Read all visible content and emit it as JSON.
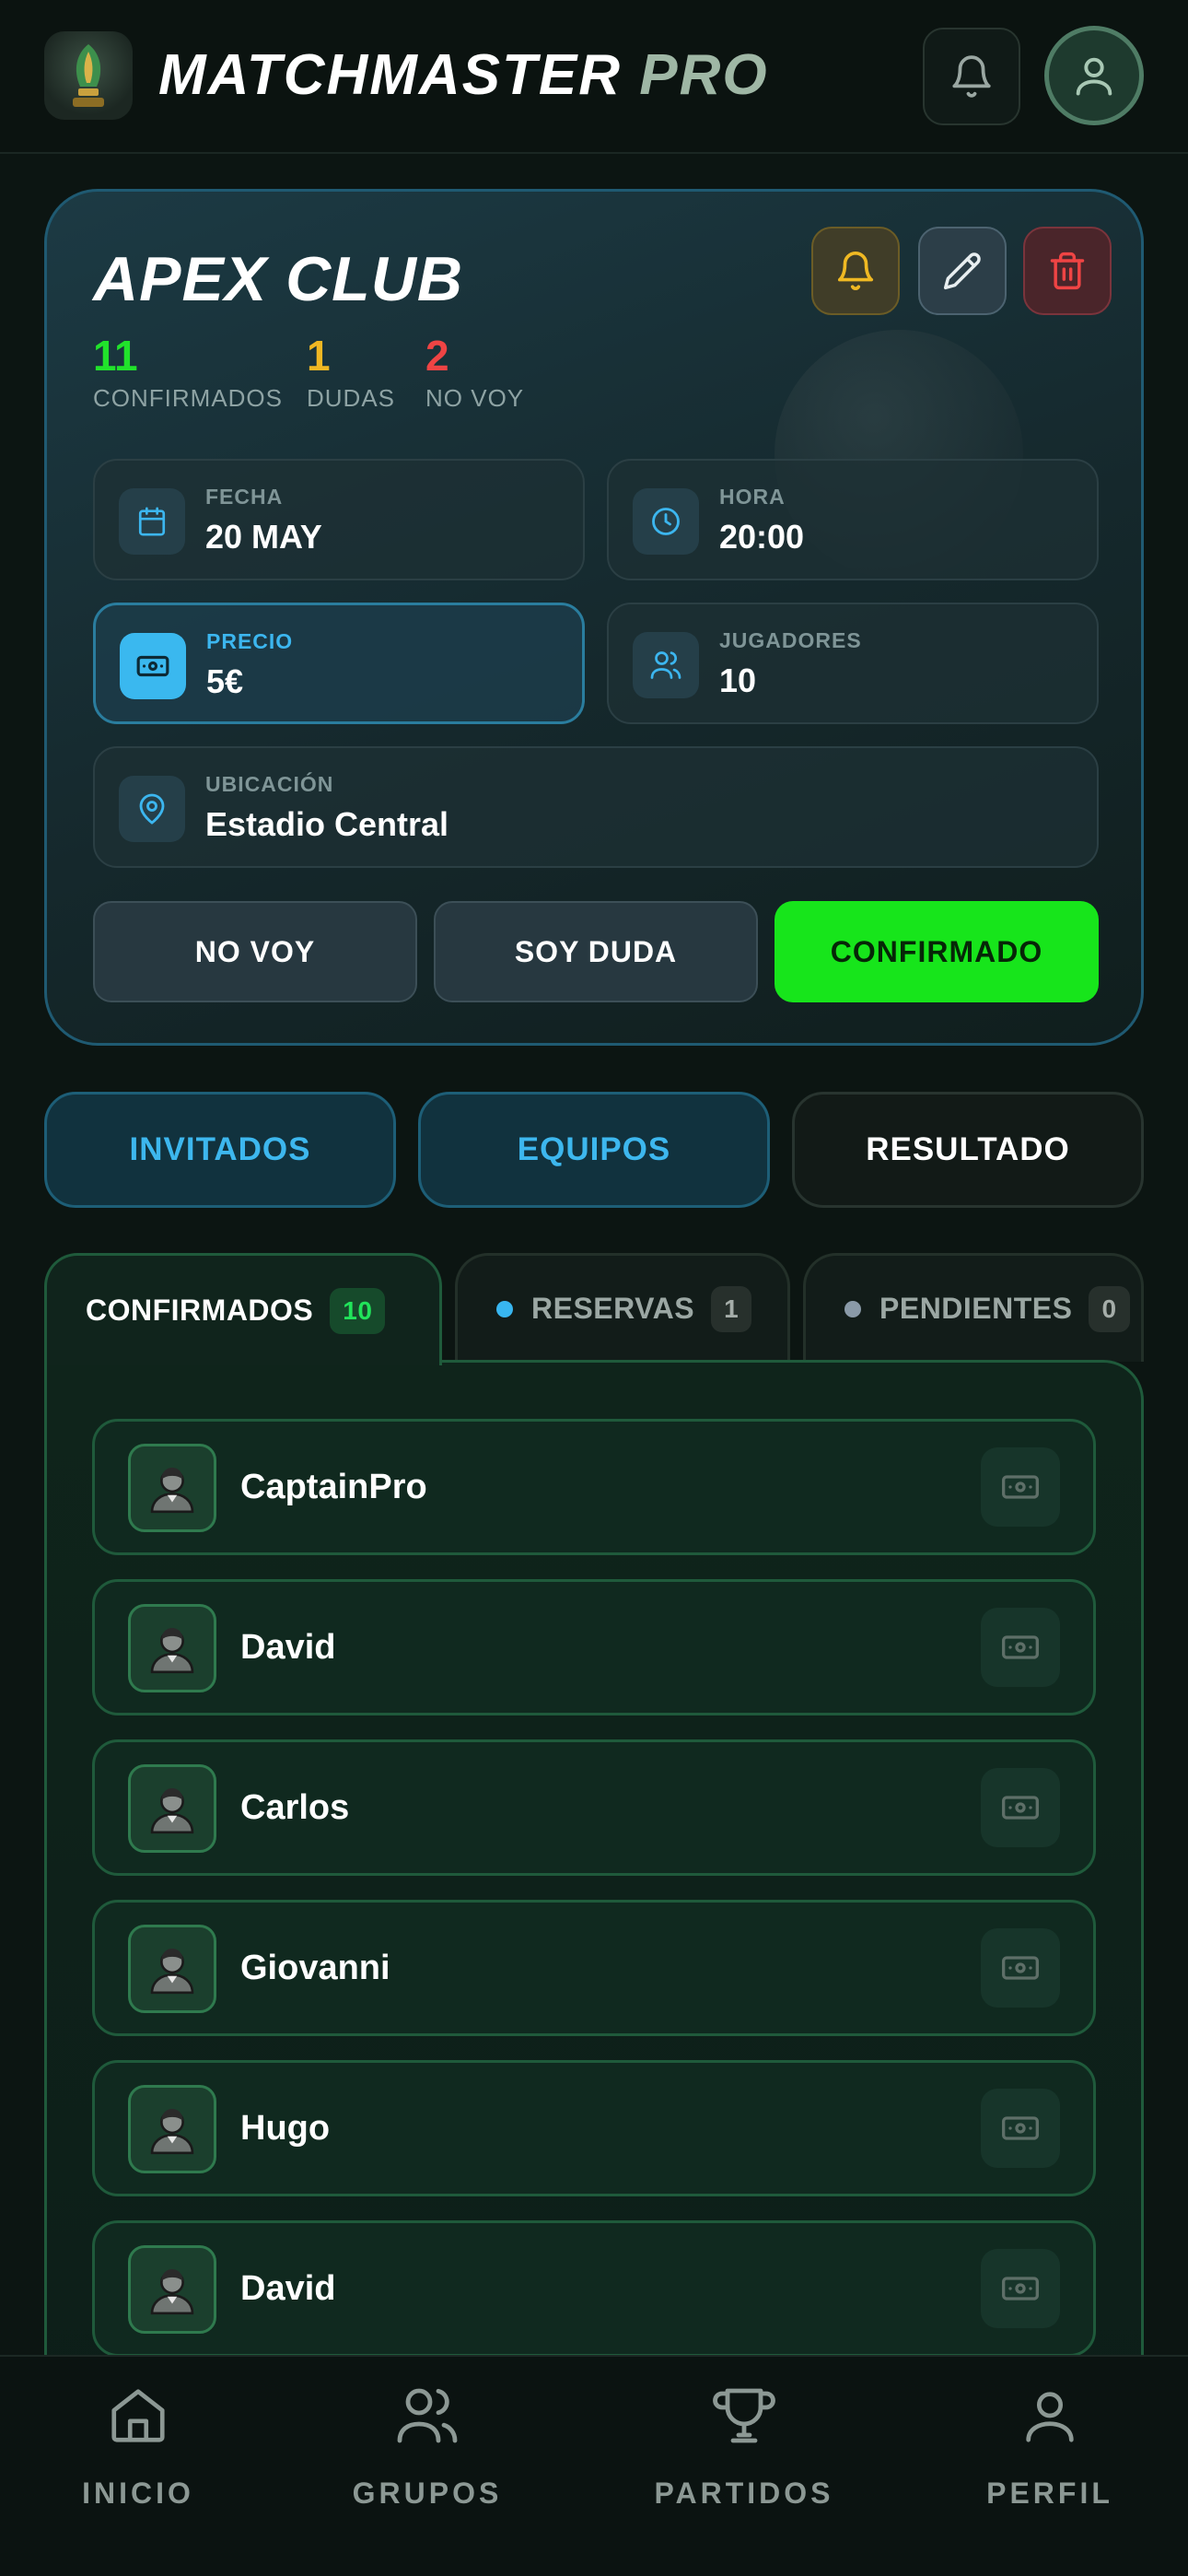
{
  "header": {
    "brand_main": "MATCHMASTER",
    "brand_accent": "PRO",
    "logo_icon": "trophy-icon",
    "notifications_icon": "bell-icon",
    "profile_icon": "user-icon"
  },
  "match": {
    "name": "APEX CLUB",
    "actions": {
      "notify_icon": "bell-icon",
      "edit_icon": "pencil-icon",
      "delete_icon": "trash-icon"
    },
    "stats": [
      {
        "value": "11",
        "label": "CONFIRMADOS",
        "color": "#21e32b"
      },
      {
        "value": "1",
        "label": "DUDAS",
        "color": "#f0b723"
      },
      {
        "value": "2",
        "label": "NO VOY",
        "color": "#ef4444"
      }
    ],
    "info": {
      "fecha": {
        "label": "FECHA",
        "value": "20 MAY",
        "icon": "calendar-icon"
      },
      "hora": {
        "label": "HORA",
        "value": "20:00",
        "icon": "clock-icon"
      },
      "precio": {
        "label": "PRECIO",
        "value": "5€",
        "icon": "cash-icon"
      },
      "jugadores": {
        "label": "JUGADORES",
        "value": "10",
        "icon": "users-icon"
      },
      "ubicacion": {
        "label": "UBICACIÓN",
        "value": "Estadio Central",
        "icon": "map-pin-icon"
      }
    },
    "buttons": {
      "no_voy": "NO VOY",
      "soy_duda": "SOY DUDA",
      "confirmado": "CONFIRMADO"
    }
  },
  "section_tabs": [
    "INVITADOS",
    "EQUIPOS",
    "RESULTADO"
  ],
  "list_tabs": [
    {
      "label": "CONFIRMADOS",
      "count": "10",
      "active": true
    },
    {
      "label": "RESERVAS",
      "count": "1",
      "dot_color": "#38b6f0"
    },
    {
      "label": "PENDIENTES",
      "count": "0",
      "dot_color": "#8a9aa8"
    }
  ],
  "players": [
    {
      "name": "CaptainPro"
    },
    {
      "name": "David"
    },
    {
      "name": "Carlos"
    },
    {
      "name": "Giovanni"
    },
    {
      "name": "Hugo"
    },
    {
      "name": "David"
    }
  ],
  "bottom_nav": [
    {
      "label": "INICIO",
      "icon": "home-icon"
    },
    {
      "label": "GRUPOS",
      "icon": "users-icon"
    },
    {
      "label": "PARTIDOS",
      "icon": "trophy-icon"
    },
    {
      "label": "PERFIL",
      "icon": "user-icon"
    }
  ],
  "colors": {
    "accent_green": "#17e51b",
    "accent_blue": "#3db7ee",
    "background": "#0c1512"
  }
}
